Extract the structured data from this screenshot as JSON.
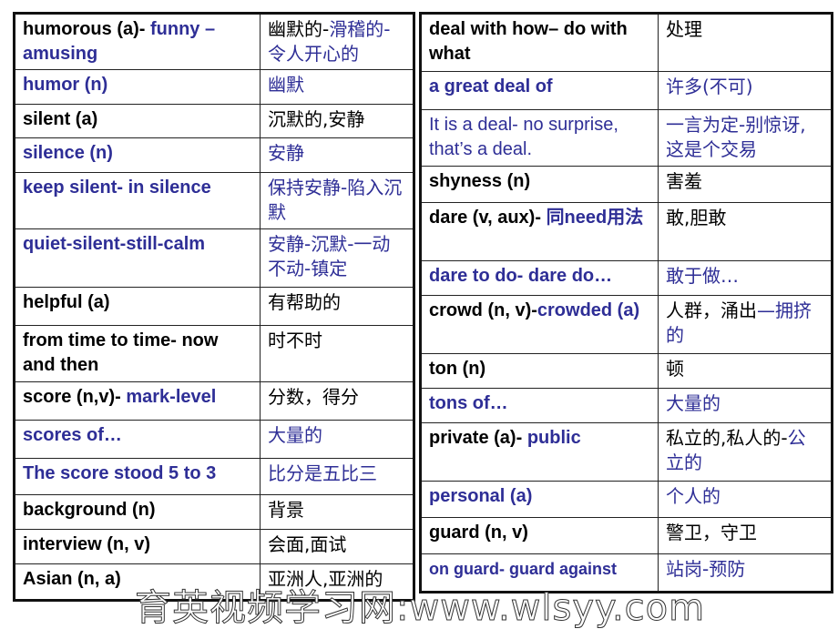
{
  "colors": {
    "black": "#000000",
    "blue": "#2e2e96"
  },
  "left_table": [
    {
      "en": [
        {
          "t": "humorous  (a)- ",
          "c": "black"
        },
        {
          "t": "funny – amusing",
          "c": "blue"
        }
      ],
      "zh": [
        {
          "t": "幽默的-",
          "c": "black"
        },
        {
          "t": "滑稽的-令人开心的",
          "c": "blue"
        }
      ]
    },
    {
      "en": [
        {
          "t": "humor (n)",
          "c": "blue"
        }
      ],
      "zh": [
        {
          "t": "幽默",
          "c": "blue"
        }
      ]
    },
    {
      "en": [
        {
          "t": "silent (a)",
          "c": "black"
        }
      ],
      "zh": [
        {
          "t": "沉默的,安静",
          "c": "black"
        }
      ]
    },
    {
      "en": [
        {
          "t": "silence (n)",
          "c": "blue"
        }
      ],
      "zh": [
        {
          "t": "安静",
          "c": "blue"
        }
      ]
    },
    {
      "en": [
        {
          "t": "keep silent- in silence",
          "c": "blue"
        }
      ],
      "zh": [
        {
          "t": "保持安静-陷入沉默",
          "c": "blue"
        }
      ]
    },
    {
      "en": [
        {
          "t": "quiet-silent-still-calm",
          "c": "blue"
        }
      ],
      "zh": [
        {
          "t": "安静-沉默-一动不动-镇定",
          "c": "blue"
        }
      ]
    },
    {
      "en": [
        {
          "t": "helpful (a)",
          "c": "black"
        }
      ],
      "zh": [
        {
          "t": "有帮助的",
          "c": "black"
        }
      ]
    },
    {
      "en": [
        {
          "t": "from time to time- now and then",
          "c": "black"
        }
      ],
      "zh": [
        {
          "t": "时不时",
          "c": "black"
        }
      ]
    },
    {
      "en": [
        {
          "t": "score (n,v)- ",
          "c": "black"
        },
        {
          "t": "mark-level",
          "c": "blue"
        }
      ],
      "zh": [
        {
          "t": "分数，得分",
          "c": "black"
        }
      ]
    },
    {
      "en": [
        {
          "t": "scores of…",
          "c": "blue"
        }
      ],
      "zh": [
        {
          "t": "大量的",
          "c": "blue"
        }
      ]
    },
    {
      "en": [
        {
          "t": "The score stood 5 to 3",
          "c": "blue"
        }
      ],
      "zh": [
        {
          "t": "比分是五比三",
          "c": "blue"
        }
      ]
    },
    {
      "en": [
        {
          "t": "background (n)",
          "c": "black"
        }
      ],
      "zh": [
        {
          "t": "背景",
          "c": "black"
        }
      ]
    },
    {
      "en": [
        {
          "t": "interview (n, v)",
          "c": "black"
        }
      ],
      "zh": [
        {
          "t": "会面,面试",
          "c": "black"
        }
      ]
    },
    {
      "en": [
        {
          "t": "Asian (n, a)",
          "c": "black"
        }
      ],
      "zh": [
        {
          "t": "亚洲人,亚洲的",
          "c": "black"
        }
      ]
    }
  ],
  "right_table": [
    {
      "en": [
        {
          "t": "deal with how– do with what",
          "c": "black"
        }
      ],
      "zh": [
        {
          "t": "处理",
          "c": "black"
        }
      ]
    },
    {
      "en": [
        {
          "t": "a great deal of",
          "c": "blue"
        }
      ],
      "zh": [
        {
          "t": "许多(不可)",
          "c": "blue"
        }
      ]
    },
    {
      "en": [
        {
          "t": "It is a deal- no surprise, that’s a deal.",
          "c": "blue",
          "light": true
        }
      ],
      "zh": [
        {
          "t": "一言为定-别惊讶,这是个交易",
          "c": "blue"
        }
      ]
    },
    {
      "en": [
        {
          "t": "shyness (n)",
          "c": "black"
        }
      ],
      "zh": [
        {
          "t": "害羞",
          "c": "black"
        }
      ]
    },
    {
      "en": [
        {
          "t": "dare (v, aux)- ",
          "c": "black"
        },
        {
          "t": "同need用法",
          "c": "blue"
        }
      ],
      "zh": [
        {
          "t": "敢,胆敢",
          "c": "black"
        }
      ]
    },
    {
      "en": [
        {
          "t": "dare to do- dare do…",
          "c": "blue"
        }
      ],
      "zh": [
        {
          "t": "敢于做…",
          "c": "blue"
        }
      ]
    },
    {
      "en": [
        {
          "t": "crowd (n, v)-",
          "c": "black"
        },
        {
          "t": "crowded (a)",
          "c": "blue"
        }
      ],
      "zh": [
        {
          "t": "人群，涌出",
          "c": "black"
        },
        {
          "t": "—拥挤的",
          "c": "blue"
        }
      ]
    },
    {
      "en": [
        {
          "t": "ton (n)",
          "c": "black"
        }
      ],
      "zh": [
        {
          "t": "顿",
          "c": "black"
        }
      ]
    },
    {
      "en": [
        {
          "t": "tons of…",
          "c": "blue"
        }
      ],
      "zh": [
        {
          "t": "大量的",
          "c": "blue"
        }
      ]
    },
    {
      "en": [
        {
          "t": "private (a)- ",
          "c": "black"
        },
        {
          "t": "public",
          "c": "blue"
        }
      ],
      "zh": [
        {
          "t": "私立的,私人的-",
          "c": "black"
        },
        {
          "t": "公立的",
          "c": "blue"
        }
      ]
    },
    {
      "en": [
        {
          "t": "personal (a)",
          "c": "blue"
        }
      ],
      "zh": [
        {
          "t": "个人的",
          "c": "blue"
        }
      ]
    },
    {
      "en": [
        {
          "t": "guard (n, v)",
          "c": "black"
        }
      ],
      "zh": [
        {
          "t": "警卫，守卫",
          "c": "black"
        }
      ]
    },
    {
      "en": [
        {
          "t": "on guard- guard against",
          "c": "blue",
          "small": true
        }
      ],
      "zh": [
        {
          "t": "站岗-预防",
          "c": "blue"
        }
      ]
    }
  ],
  "watermark": "育英视频学习网:www.wlsyy.com"
}
